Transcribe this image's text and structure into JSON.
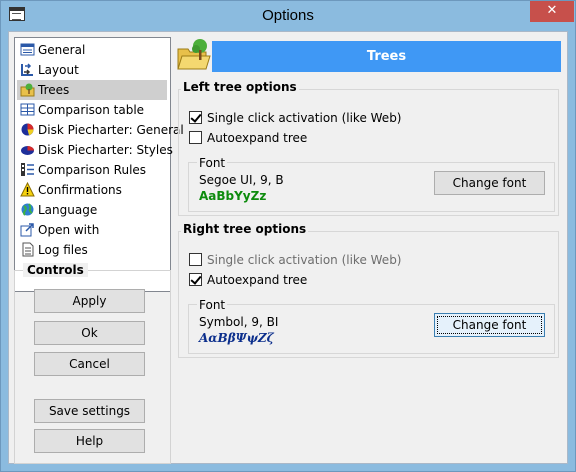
{
  "window": {
    "title": "Options",
    "close_glyph": "✕"
  },
  "nav": {
    "items": [
      {
        "label": "General",
        "icon": "general-icon"
      },
      {
        "label": "Layout",
        "icon": "layout-icon"
      },
      {
        "label": "Trees",
        "icon": "trees-icon",
        "selected": true
      },
      {
        "label": "Comparison table",
        "icon": "comparison-table-icon"
      },
      {
        "label": "Disk Piecharter: General",
        "icon": "piechart-icon"
      },
      {
        "label": "Disk Piecharter: Styles",
        "icon": "piechart-styles-icon"
      },
      {
        "label": "Comparison Rules",
        "icon": "rules-icon"
      },
      {
        "label": "Confirmations",
        "icon": "warning-icon"
      },
      {
        "label": "Language",
        "icon": "globe-icon"
      },
      {
        "label": "Open with",
        "icon": "open-with-icon"
      },
      {
        "label": "Log files",
        "icon": "log-files-icon"
      }
    ]
  },
  "controls": {
    "title": "Controls",
    "apply": "Apply",
    "ok": "Ok",
    "cancel": "Cancel",
    "save_settings": "Save settings",
    "help": "Help"
  },
  "panel": {
    "header": "Trees",
    "left": {
      "title": "Left tree options",
      "single_click": "Single click activation (like Web)",
      "single_click_checked": true,
      "autoexpand": "Autoexpand tree",
      "autoexpand_checked": false,
      "font_label": "Font",
      "font_value": "Segoe UI, 9, B",
      "font_sample": "AaBbYyZz",
      "change_font": "Change font"
    },
    "right": {
      "title": "Right tree options",
      "single_click": "Single click activation (like Web)",
      "single_click_checked": false,
      "autoexpand": "Autoexpand tree",
      "autoexpand_checked": true,
      "font_label": "Font",
      "font_value": "Symbol, 9, BI",
      "font_sample": "ΑαΒβΨψΖζ",
      "change_font": "Change font"
    }
  },
  "colors": {
    "header_blue": "#3f98f5",
    "close_red": "#c7504b",
    "sample_green": "#0d8b0d",
    "sample_navy": "#0b2e8c"
  }
}
